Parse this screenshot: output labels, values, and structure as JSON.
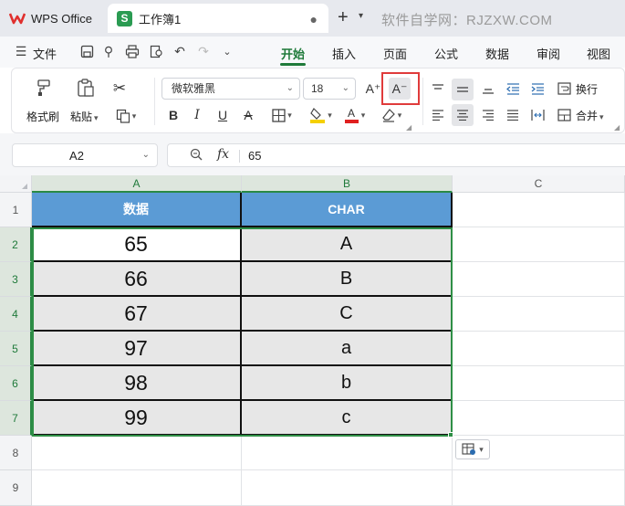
{
  "titlebar": {
    "app_tab": "WPS Office",
    "doc_tab": "工作簿1",
    "doc_tab_icon": "S",
    "modified_dot": "●",
    "new_tab": "+",
    "watermark": "软件自学网：RJZXW.COM"
  },
  "menubar": {
    "file": "文件",
    "tabs": [
      "开始",
      "插入",
      "页面",
      "公式",
      "数据",
      "审阅",
      "视图"
    ],
    "active_tab": "开始"
  },
  "ribbon": {
    "format_painter": "格式刷",
    "paste": "粘贴",
    "font_name": "微软雅黑",
    "font_size": "18",
    "bold": "B",
    "italic": "I",
    "underline": "U",
    "strikethrough": "A",
    "grow_font": "A⁺",
    "shrink_font": "A⁻",
    "wrap_text": "换行",
    "merge": "合并",
    "highlighted_button": "shrink-font-button",
    "highlight_color": "#e03b3b",
    "fill_color": "#f5d000",
    "font_color": "#e02020"
  },
  "formula_bar": {
    "name_box": "A2",
    "fx": "fx",
    "value": "65"
  },
  "sheet": {
    "columns": [
      "A",
      "B",
      "C"
    ],
    "rows": [
      "1",
      "2",
      "3",
      "4",
      "5",
      "6",
      "7",
      "8",
      "9"
    ],
    "headers": [
      "数据",
      "CHAR"
    ],
    "data": [
      [
        "65",
        "A"
      ],
      [
        "66",
        "B"
      ],
      [
        "67",
        "C"
      ],
      [
        "97",
        "a"
      ],
      [
        "98",
        "b"
      ],
      [
        "99",
        "c"
      ]
    ],
    "header_fill": "#5b9bd5",
    "body_fill": "#e7e7e7",
    "selection_color": "#2f8f46"
  }
}
